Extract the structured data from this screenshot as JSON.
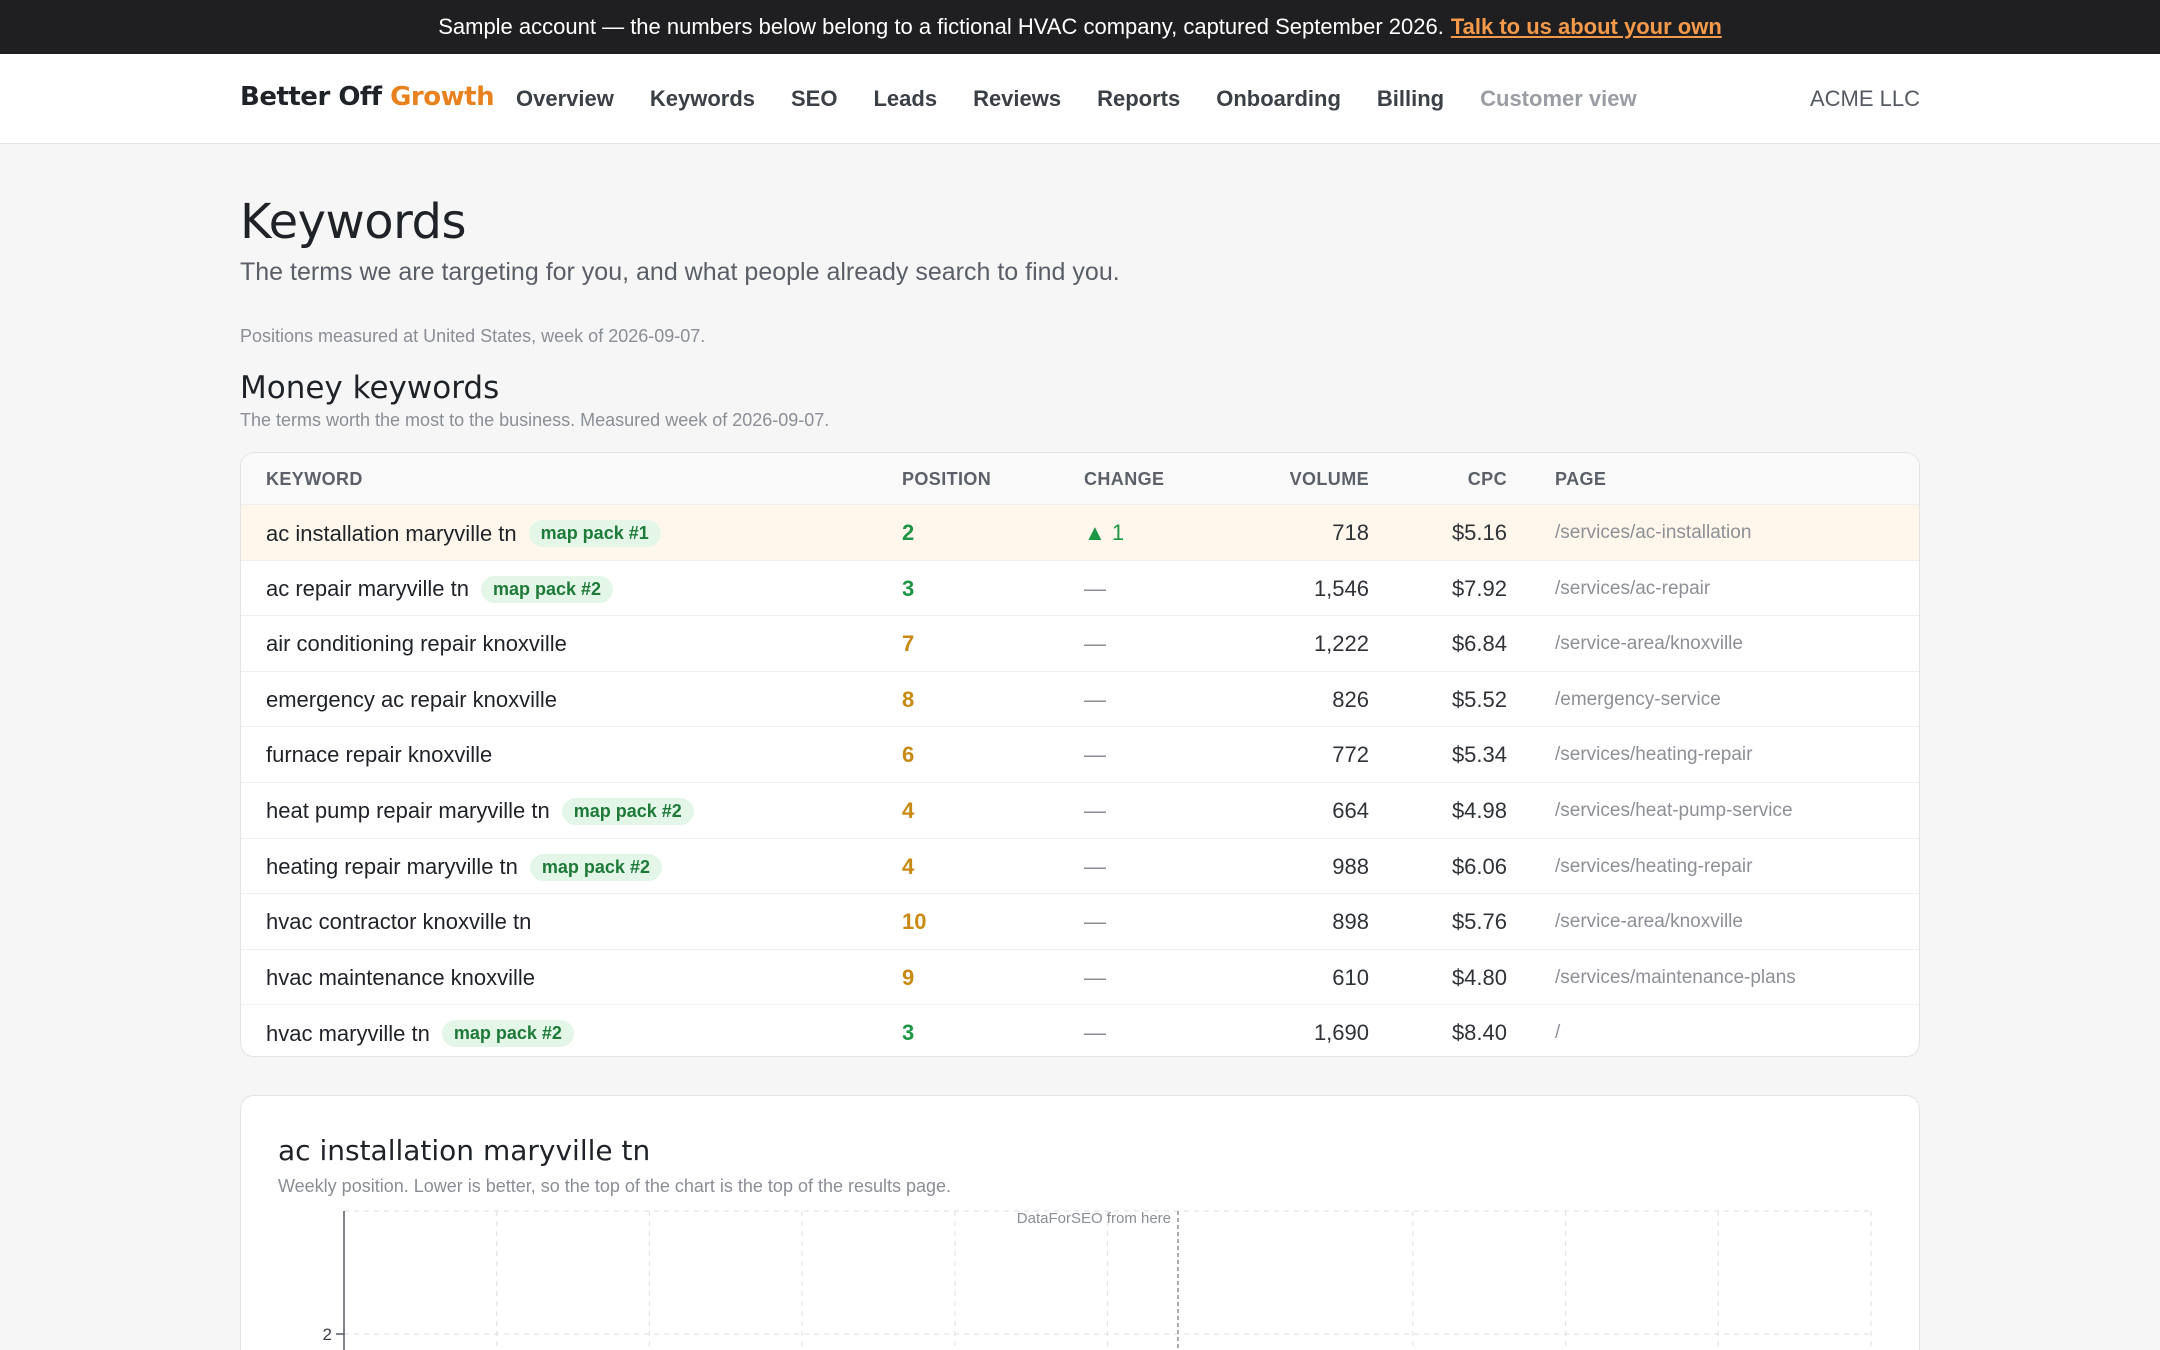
{
  "banner": {
    "text": "Sample account — the numbers below belong to a fictional HVAC company, captured September 2026.",
    "link": "Talk to us about your own"
  },
  "brand": {
    "part1": "Better Off ",
    "part2": "Growth",
    "accent_color": "#e8821e"
  },
  "nav": {
    "items": [
      "Overview",
      "Keywords",
      "SEO",
      "Leads",
      "Reviews",
      "Reports",
      "Onboarding",
      "Billing"
    ],
    "muted_item": "Customer view",
    "account": "ACME LLC"
  },
  "page": {
    "title": "Keywords",
    "subtitle": "The terms we are targeting for you, and what people already search to find you.",
    "measure_note": "Positions measured at United States, week of 2026-09-07."
  },
  "money": {
    "title": "Money keywords",
    "note": "The terms worth the most to the business. Measured week of 2026-09-07.",
    "columns": [
      "KEYWORD",
      "POSITION",
      "CHANGE",
      "VOLUME",
      "CPC",
      "PAGE"
    ],
    "rows": [
      {
        "keyword": "ac installation maryville tn",
        "badge": "map pack #1",
        "position": "2",
        "change": "▲ 1",
        "volume": "718",
        "cpc": "$5.16",
        "page": "/services/ac-installation"
      },
      {
        "keyword": "ac repair maryville tn",
        "badge": "map pack #2",
        "position": "3",
        "change": "—",
        "volume": "1,546",
        "cpc": "$7.92",
        "page": "/services/ac-repair"
      },
      {
        "keyword": "air conditioning repair knoxville",
        "badge": "",
        "position": "7",
        "change": "—",
        "volume": "1,222",
        "cpc": "$6.84",
        "page": "/service-area/knoxville"
      },
      {
        "keyword": "emergency ac repair knoxville",
        "badge": "",
        "position": "8",
        "change": "—",
        "volume": "826",
        "cpc": "$5.52",
        "page": "/emergency-service"
      },
      {
        "keyword": "furnace repair knoxville",
        "badge": "",
        "position": "6",
        "change": "—",
        "volume": "772",
        "cpc": "$5.34",
        "page": "/services/heating-repair"
      },
      {
        "keyword": "heat pump repair maryville tn",
        "badge": "map pack #2",
        "position": "4",
        "change": "—",
        "volume": "664",
        "cpc": "$4.98",
        "page": "/services/heat-pump-service"
      },
      {
        "keyword": "heating repair maryville tn",
        "badge": "map pack #2",
        "position": "4",
        "change": "—",
        "volume": "988",
        "cpc": "$6.06",
        "page": "/services/heating-repair"
      },
      {
        "keyword": "hvac contractor knoxville tn",
        "badge": "",
        "position": "10",
        "change": "—",
        "volume": "898",
        "cpc": "$5.76",
        "page": "/service-area/knoxville"
      },
      {
        "keyword": "hvac maintenance knoxville",
        "badge": "",
        "position": "9",
        "change": "—",
        "volume": "610",
        "cpc": "$4.80",
        "page": "/services/maintenance-plans"
      },
      {
        "keyword": "hvac maryville tn",
        "badge": "map pack #2",
        "position": "3",
        "change": "—",
        "volume": "1,690",
        "cpc": "$8.40",
        "page": "/"
      }
    ]
  },
  "chart": {
    "title": "ac installation maryville tn",
    "subtitle": "Weekly position. Lower is better, so the top of the chart is the top of the results page.",
    "annotation": "DataForSEO from here",
    "tick_label": "2"
  },
  "chart_data": {
    "type": "line",
    "title": "ac installation maryville tn",
    "xlabel": "",
    "ylabel": "",
    "y_inverted": true,
    "y_tick_visible": [
      2
    ],
    "annotation": "DataForSEO from here",
    "series": [
      {
        "values": [
          2
        ]
      }
    ],
    "line_color": "#e8821e",
    "grid": true
  }
}
